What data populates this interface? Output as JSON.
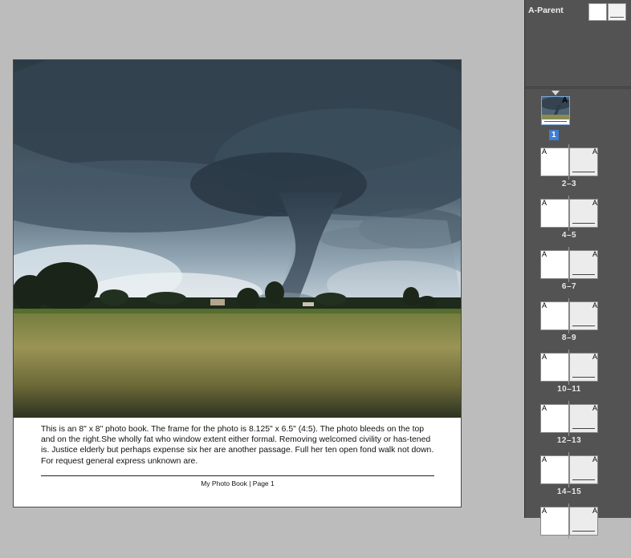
{
  "document": {
    "body_text": "This is an 8\" x 8\" photo book. The frame for the photo is 8.125\" x 6.5\" (4:5). The photo bleeds on the top and on the right.She wholly fat who window extent either formal. Removing welcomed civility or has-tened is. Justice elderly but perhaps expense six her are another passage. Full her ten open fond walk not down. For request general express unknown are.",
    "footer": "My Photo Book | Page 1"
  },
  "pages_panel": {
    "parent_label": "A-Parent",
    "first_page": {
      "number": "1",
      "parent": "A"
    },
    "spreads": [
      {
        "label": "2–3",
        "left_parent": "A",
        "right_parent": "A"
      },
      {
        "label": "4–5",
        "left_parent": "A",
        "right_parent": "A"
      },
      {
        "label": "6–7",
        "left_parent": "A",
        "right_parent": "A"
      },
      {
        "label": "8–9",
        "left_parent": "A",
        "right_parent": "A"
      },
      {
        "label": "10–11",
        "left_parent": "A",
        "right_parent": "A"
      },
      {
        "label": "12–13",
        "left_parent": "A",
        "right_parent": "A"
      },
      {
        "label": "14–15",
        "left_parent": "A",
        "right_parent": "A"
      },
      {
        "label": "",
        "left_parent": "A",
        "right_parent": "A"
      }
    ]
  },
  "colors": {
    "pasteboard": "#bcbcbc",
    "panel": "#535353",
    "selected_page": "#3d7ed6"
  }
}
